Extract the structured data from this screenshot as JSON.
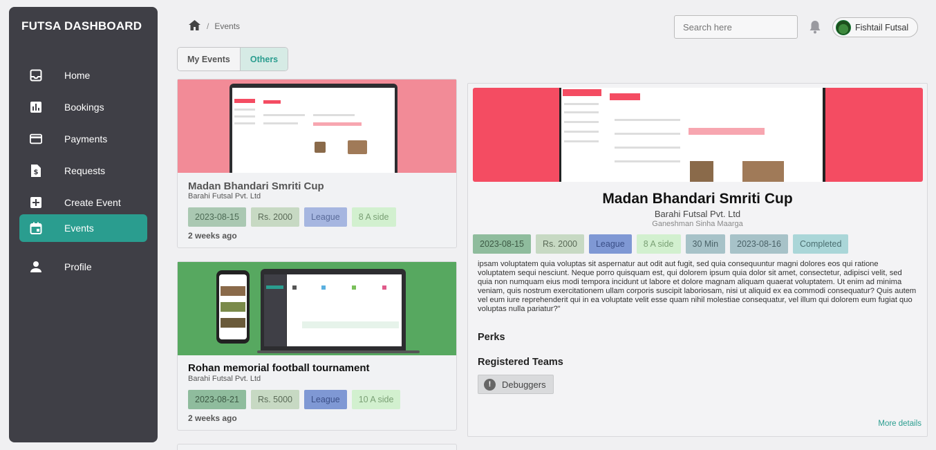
{
  "sidebar": {
    "brand": "FUTSA DASHBOARD",
    "items": [
      {
        "label": "Home",
        "icon": "inbox-icon"
      },
      {
        "label": "Bookings",
        "icon": "bar-chart-icon"
      },
      {
        "label": "Payments",
        "icon": "credit-card-icon"
      },
      {
        "label": "Requests",
        "icon": "dollar-document-icon"
      },
      {
        "label": "Create Event",
        "icon": "plus-box-icon"
      },
      {
        "label": "Events",
        "icon": "calendar-icon",
        "active": true
      },
      {
        "label": "Profile",
        "icon": "person-icon"
      }
    ]
  },
  "header": {
    "breadcrumb": {
      "home_icon": "home-icon",
      "separator": "/",
      "current": "Events"
    },
    "search_placeholder": "Search here",
    "user_name": "Fishtail Futsal"
  },
  "tabs": [
    {
      "label": "My Events",
      "active": false
    },
    {
      "label": "Others",
      "active": true
    }
  ],
  "events": [
    {
      "title": "Madan Bhandari Smriti Cup",
      "organizer": "Barahi Futsal Pvt. Ltd",
      "date": "2023-08-15",
      "price": "Rs. 2000",
      "type": "League",
      "side": "8 A side",
      "posted": "2 weeks ago",
      "thumb_color": "#f28b97"
    },
    {
      "title": "Rohan memorial football tournament",
      "organizer": "Barahi Futsal Pvt. Ltd",
      "date": "2023-08-21",
      "price": "Rs. 5000",
      "type": "League",
      "side": "10 A side",
      "posted": "2 weeks ago",
      "thumb_color": "#57a860"
    }
  ],
  "detail": {
    "title": "Madan Bhandari Smriti Cup",
    "organizer": "Barahi Futsal Pvt. Ltd",
    "location": "Ganeshman Sinha Maarga",
    "date": "2023-08-15",
    "price": "Rs. 2000",
    "type": "League",
    "side": "8 A side",
    "duration": "30 Min",
    "end_date": "2023-08-16",
    "status": "Completed",
    "description": "ipsam voluptatem quia voluptas sit aspernatur aut odit aut fugit, sed quia consequuntur magni dolores eos qui ratione voluptatem sequi nesciunt. Neque porro quisquam est, qui dolorem ipsum quia dolor sit amet, consectetur, adipisci velit, sed quia non numquam eius modi tempora incidunt ut labore et dolore magnam aliquam quaerat voluptatem. Ut enim ad minima veniam, quis nostrum exercitationem ullam corporis suscipit laboriosam, nisi ut aliquid ex ea commodi consequatur? Quis autem vel eum iure reprehenderit qui in ea voluptate velit esse quam nihil molestiae consequatur, vel illum qui dolorem eum fugiat quo voluptas nulla pariatur?\"",
    "perks_heading": "Perks",
    "teams_heading": "Registered Teams",
    "teams": [
      "Debuggers"
    ],
    "more_link": "More details"
  },
  "colors": {
    "sidebar_bg": "#3f3f46",
    "accent": "#2a9d8f",
    "hero_red": "#f44c62"
  }
}
